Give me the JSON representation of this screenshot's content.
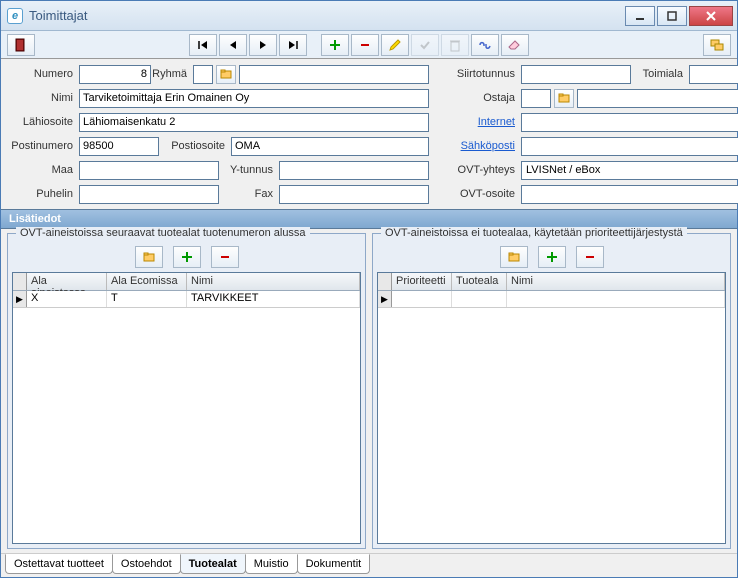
{
  "title": "Toimittajat",
  "fields": {
    "numero_label": "Numero",
    "numero_value": "8",
    "ryhma_label": "Ryhmä",
    "ryhma_value": "",
    "nimi_label": "Nimi",
    "nimi_value": "Tarviketoimittaja Erin Omainen Oy",
    "lahiosoite_label": "Lähiosoite",
    "lahiosoite_value": "Lähiomaisenkatu 2",
    "postinumero_label": "Postinumero",
    "postinumero_value": "98500",
    "postiosoite_label": "Postiosoite",
    "postiosoite_value": "OMA",
    "maa_label": "Maa",
    "maa_value": "",
    "ytunnus_label": "Y-tunnus",
    "ytunnus_value": "",
    "puhelin_label": "Puhelin",
    "puhelin_value": "",
    "fax_label": "Fax",
    "fax_value": "",
    "siirtotunnus_label": "Siirtotunnus",
    "siirtotunnus_value": "",
    "toimiala_label": "Toimiala",
    "toimiala_value": "",
    "ostaja_label": "Ostaja",
    "ostaja_value": "",
    "internet_label": "Internet",
    "internet_value": "",
    "sahkoposti_label": "Sähköposti",
    "sahkoposti_value": "",
    "ovt_yhteys_label": "OVT-yhteys",
    "ovt_yhteys_value": "LVISNet / eBox",
    "ovt_osoite_label": "OVT-osoite",
    "ovt_osoite_value": ""
  },
  "section_header": "Lisätiedot",
  "group_left_label": "OVT-aineistoissa seuraavat tuotealat tuotenumeron alussa",
  "group_right_label": "OVT-aineistoissa ei tuotealaa, käytetään prioriteettijärjestystä",
  "grid_left": {
    "headers": [
      "Ala aineistossa",
      "Ala Ecomissa",
      "Nimi"
    ],
    "rows": [
      {
        "c0": "X",
        "c1": "T",
        "c2": "TARVIKKEET"
      }
    ]
  },
  "grid_right": {
    "headers": [
      "Prioriteetti",
      "Tuoteala",
      "Nimi"
    ],
    "rows": []
  },
  "tabs": [
    "Ostettavat tuotteet",
    "Ostoehdot",
    "Tuotealat",
    "Muistio",
    "Dokumentit"
  ],
  "active_tab": 2
}
